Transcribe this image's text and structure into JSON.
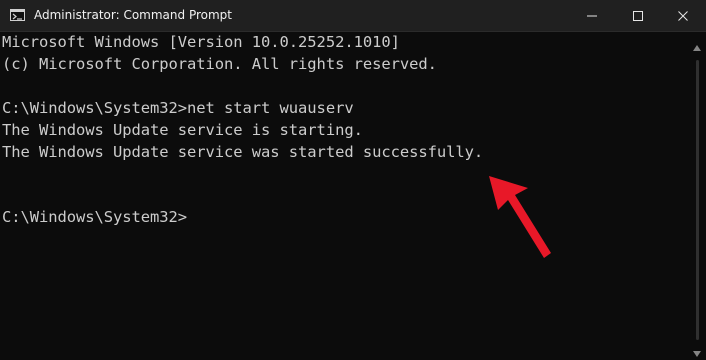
{
  "window": {
    "title": "Administrator: Command Prompt",
    "controls": [
      "minimize",
      "maximize",
      "close"
    ]
  },
  "terminal": {
    "lines": [
      "Microsoft Windows [Version 10.0.25252.1010]",
      "(c) Microsoft Corporation. All rights reserved.",
      "C:\\Windows\\System32>net start wuauserv",
      "The Windows Update service is starting.",
      "The Windows Update service was started successfully.",
      "C:\\Windows\\System32>"
    ],
    "background": "#0c0c0c",
    "text_color": "#cccccc"
  },
  "icons": {
    "app": "command-prompt-icon",
    "minimize": "minimize-icon",
    "maximize": "maximize-icon",
    "close": "close-icon",
    "scroll_up": "chevron-up-icon",
    "scroll_down": "chevron-down-icon",
    "annotation": "red-arrow-icon"
  },
  "colors": {
    "titlebar": "#202020",
    "annotation_arrow": "#e81828"
  }
}
